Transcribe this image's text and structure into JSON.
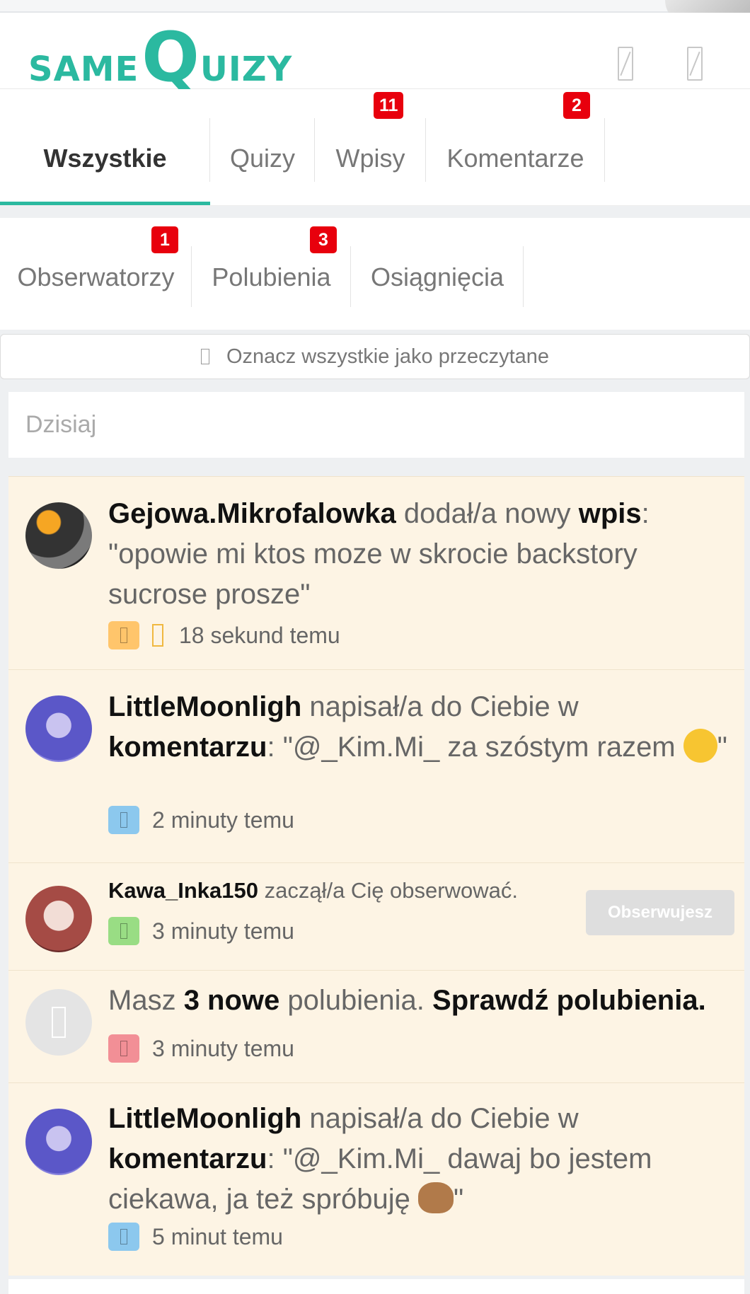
{
  "header": {
    "logo_left": "SAME",
    "logo_q": "Q",
    "logo_right": "UIZY"
  },
  "tabs_row1": [
    {
      "label": "Wszystkie",
      "active": true,
      "badge": ""
    },
    {
      "label": "Quizy",
      "active": false,
      "badge": ""
    },
    {
      "label": "Wpisy",
      "active": false,
      "badge": "11"
    },
    {
      "label": "Komentarze",
      "active": false,
      "badge": "2"
    }
  ],
  "tabs_row2": [
    {
      "label": "Obserwatorzy",
      "badge": "1"
    },
    {
      "label": "Polubienia",
      "badge": "3"
    },
    {
      "label": "Osiągnięcia",
      "badge": ""
    }
  ],
  "mark_all_label": "Oznacz wszystkie jako przeczytane",
  "day_header": "Dzisiaj",
  "notifications": [
    {
      "user": "Gejowa.Mikrofalowka",
      "action": " dodał/a nowy ",
      "object": "wpis",
      "suffix": ":",
      "quote": "\"opowie mi ktos moze w skrocie backstory sucrose prosze\"",
      "time": "18 sekund temu",
      "tag_color": "#ffc56b"
    },
    {
      "user": "LittleMoonligh",
      "action": " napisał/a do Ciebie w ",
      "object": "komentarzu",
      "quote_prefix": ": \"@_Kim.Mi_ za szóstym razem ",
      "quote_suffix": "\"",
      "time": "2 minuty temu",
      "tag_color": "#8cc8ee"
    },
    {
      "user": "Kawa_Inka150",
      "action": " zaczął/a Cię obserwować.",
      "time": "3 minuty temu",
      "button": "Obserwujesz",
      "tag_color": "#99dd84"
    },
    {
      "prefix": "Masz ",
      "count": "3 nowe",
      "middle": " polubienia. ",
      "link": "Sprawdź polubienia.",
      "time": "3 minuty temu",
      "tag_color": "#f28f96"
    },
    {
      "user": "LittleMoonligh",
      "action": " napisał/a do Ciebie w ",
      "object": "komentarzu",
      "quote_prefix": ": \"@_Kim.Mi_ dawaj bo jestem ciekawa, ja też spróbuję ",
      "quote_suffix": "\"",
      "time": "5 minut temu",
      "tag_color": "#8cc8ee"
    }
  ]
}
